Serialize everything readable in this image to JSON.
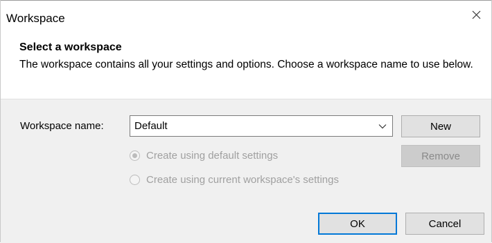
{
  "window": {
    "title": "Workspace",
    "close_icon": "close-icon"
  },
  "header": {
    "heading": "Select a workspace",
    "description": "The workspace contains all your settings and options. Choose a workspace name to use below."
  },
  "form": {
    "workspace_name_label": "Workspace name:",
    "workspace_name_value": "Default",
    "dropdown_icon": "chevron-down-icon",
    "radio_default_label": "Create using default settings",
    "radio_default_selected": true,
    "radio_current_label": "Create using current workspace's settings",
    "radio_current_selected": false,
    "radios_enabled": false
  },
  "buttons": {
    "new_label": "New",
    "remove_label": "Remove",
    "remove_enabled": false,
    "ok_label": "OK",
    "cancel_label": "Cancel"
  },
  "colors": {
    "default_button_border": "#0078d7",
    "panel_background": "#f0f0f0"
  }
}
